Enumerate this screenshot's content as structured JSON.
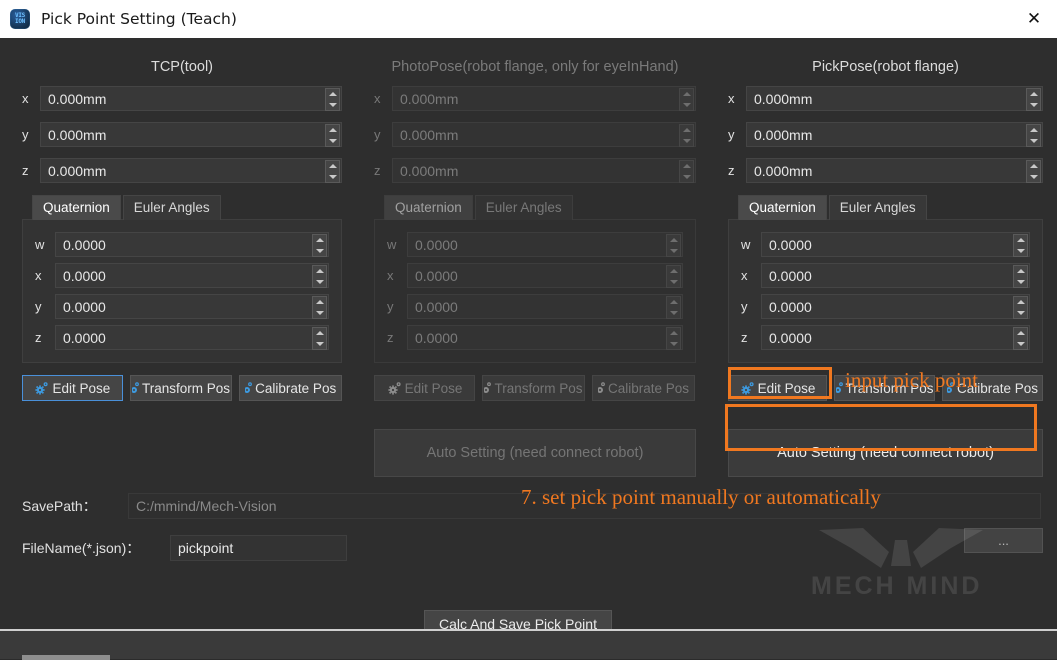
{
  "window": {
    "title": "Pick Point Setting  (Teach)",
    "app_icon": "vision-app-icon",
    "close_label": "✕"
  },
  "columns": [
    {
      "key": "tcp",
      "title": "TCP(tool)",
      "enabled": true,
      "position": [
        {
          "label": "x",
          "value": "0.000mm"
        },
        {
          "label": "y",
          "value": "0.000mm"
        },
        {
          "label": "z",
          "value": "0.000mm"
        }
      ],
      "tabs": [
        {
          "label": "Quaternion",
          "selected": true
        },
        {
          "label": "Euler Angles",
          "selected": false
        }
      ],
      "quaternion": [
        {
          "label": "w",
          "value": "0.0000"
        },
        {
          "label": "x",
          "value": "0.0000"
        },
        {
          "label": "y",
          "value": "0.0000"
        },
        {
          "label": "z",
          "value": "0.0000"
        }
      ],
      "buttons": {
        "edit": "Edit Pose",
        "transform": "Transform Pos",
        "calibrate": "Calibrate Pos"
      }
    },
    {
      "key": "photopose",
      "title": "PhotoPose(robot flange, only for eyeInHand)",
      "enabled": false,
      "position": [
        {
          "label": "x",
          "value": "0.000mm"
        },
        {
          "label": "y",
          "value": "0.000mm"
        },
        {
          "label": "z",
          "value": "0.000mm"
        }
      ],
      "tabs": [
        {
          "label": "Quaternion",
          "selected": true
        },
        {
          "label": "Euler Angles",
          "selected": false
        }
      ],
      "quaternion": [
        {
          "label": "w",
          "value": "0.0000"
        },
        {
          "label": "x",
          "value": "0.0000"
        },
        {
          "label": "y",
          "value": "0.0000"
        },
        {
          "label": "z",
          "value": "0.0000"
        }
      ],
      "buttons": {
        "edit": "Edit Pose",
        "transform": "Transform Pos",
        "calibrate": "Calibrate Pos"
      },
      "auto_setting": "Auto Setting  (need connect robot)"
    },
    {
      "key": "pickpose",
      "title": "PickPose(robot flange)",
      "enabled": true,
      "position": [
        {
          "label": "x",
          "value": "0.000mm"
        },
        {
          "label": "y",
          "value": "0.000mm"
        },
        {
          "label": "z",
          "value": "0.000mm"
        }
      ],
      "tabs": [
        {
          "label": "Quaternion",
          "selected": true
        },
        {
          "label": "Euler Angles",
          "selected": false
        }
      ],
      "quaternion": [
        {
          "label": "w",
          "value": "0.0000"
        },
        {
          "label": "x",
          "value": "0.0000"
        },
        {
          "label": "y",
          "value": "0.0000"
        },
        {
          "label": "z",
          "value": "0.0000"
        }
      ],
      "buttons": {
        "edit": "Edit Pose",
        "transform": "Transform Pos",
        "calibrate": "Calibrate Pos"
      },
      "auto_setting": "Auto Setting  (need connect robot)"
    }
  ],
  "form": {
    "savepath_label": "SavePath：",
    "savepath_value": "C:/mmind/Mech-Vision",
    "filename_label": "FileName(*.json)：",
    "filename_value": "pickpoint",
    "browse_label": "...",
    "calc_label": "Calc And Save Pick Point"
  },
  "annotations": {
    "input_pick_point": "input pick point",
    "step7": "7. set pick point manually or automatically",
    "accent_color": "#f07820"
  },
  "watermark": {
    "text": "MECH MIND"
  }
}
